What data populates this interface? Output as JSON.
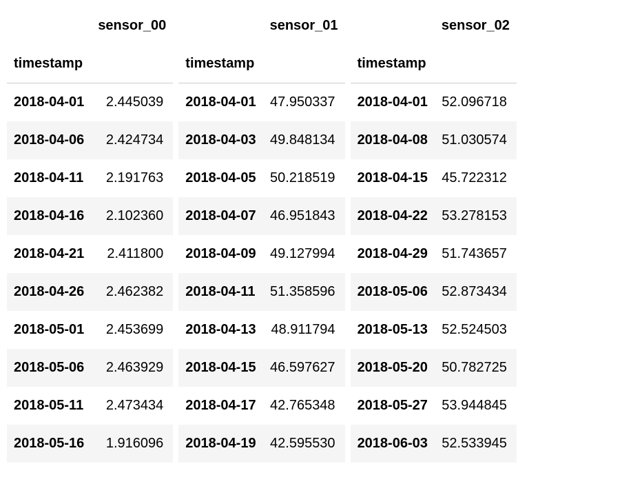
{
  "timestamp_label": "timestamp",
  "sensors": [
    {
      "name": "sensor_00",
      "rows": [
        {
          "timestamp": "2018-04-01",
          "value": "2.445039"
        },
        {
          "timestamp": "2018-04-06",
          "value": "2.424734"
        },
        {
          "timestamp": "2018-04-11",
          "value": "2.191763"
        },
        {
          "timestamp": "2018-04-16",
          "value": "2.102360"
        },
        {
          "timestamp": "2018-04-21",
          "value": "2.411800"
        },
        {
          "timestamp": "2018-04-26",
          "value": "2.462382"
        },
        {
          "timestamp": "2018-05-01",
          "value": "2.453699"
        },
        {
          "timestamp": "2018-05-06",
          "value": "2.463929"
        },
        {
          "timestamp": "2018-05-11",
          "value": "2.473434"
        },
        {
          "timestamp": "2018-05-16",
          "value": "1.916096"
        }
      ]
    },
    {
      "name": "sensor_01",
      "rows": [
        {
          "timestamp": "2018-04-01",
          "value": "47.950337"
        },
        {
          "timestamp": "2018-04-03",
          "value": "49.848134"
        },
        {
          "timestamp": "2018-04-05",
          "value": "50.218519"
        },
        {
          "timestamp": "2018-04-07",
          "value": "46.951843"
        },
        {
          "timestamp": "2018-04-09",
          "value": "49.127994"
        },
        {
          "timestamp": "2018-04-11",
          "value": "51.358596"
        },
        {
          "timestamp": "2018-04-13",
          "value": "48.911794"
        },
        {
          "timestamp": "2018-04-15",
          "value": "46.597627"
        },
        {
          "timestamp": "2018-04-17",
          "value": "42.765348"
        },
        {
          "timestamp": "2018-04-19",
          "value": "42.595530"
        }
      ]
    },
    {
      "name": "sensor_02",
      "rows": [
        {
          "timestamp": "2018-04-01",
          "value": "52.096718"
        },
        {
          "timestamp": "2018-04-08",
          "value": "51.030574"
        },
        {
          "timestamp": "2018-04-15",
          "value": "45.722312"
        },
        {
          "timestamp": "2018-04-22",
          "value": "53.278153"
        },
        {
          "timestamp": "2018-04-29",
          "value": "51.743657"
        },
        {
          "timestamp": "2018-05-06",
          "value": "52.873434"
        },
        {
          "timestamp": "2018-05-13",
          "value": "52.524503"
        },
        {
          "timestamp": "2018-05-20",
          "value": "50.782725"
        },
        {
          "timestamp": "2018-05-27",
          "value": "53.944845"
        },
        {
          "timestamp": "2018-06-03",
          "value": "52.533945"
        }
      ]
    }
  ]
}
